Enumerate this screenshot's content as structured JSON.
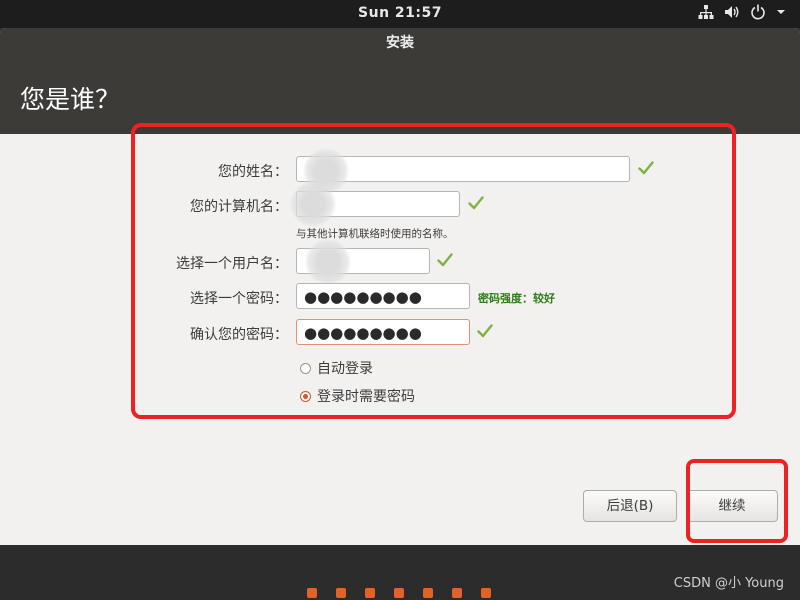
{
  "topbar": {
    "clock": "Sun 21:57"
  },
  "window": {
    "title": "安装",
    "heading": "您是谁？"
  },
  "form": {
    "name_label": "您的姓名：",
    "computer_label": "您的计算机名：",
    "computer_hint": "与其他计算机联络时使用的名称。",
    "username_label": "选择一个用户名：",
    "password_label": "选择一个密码：",
    "password_value": "●●●●●●●●●",
    "password_strength": "密码强度：较好",
    "confirm_label": "确认您的密码：",
    "confirm_value": "●●●●●●●●●",
    "auto_login_label": "自动登录",
    "require_password_label": "登录时需要密码",
    "selected_login_option": "登录时需要密码"
  },
  "buttons": {
    "back": "后退(B)",
    "continue": "继续"
  },
  "progress": {
    "total_steps": 7
  },
  "watermark": "CSDN @小 Young",
  "colors": {
    "accent": "#e2622b",
    "highlight": "#ee2222",
    "valid_check": "#7cb342",
    "strength_text": "#2e7d1b"
  }
}
